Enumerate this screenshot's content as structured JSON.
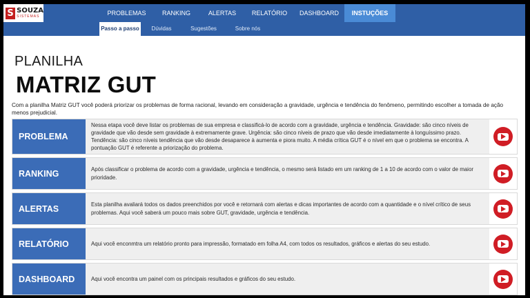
{
  "brand": {
    "name": "SOUZA",
    "sub": "SISTEMAS",
    "mark": "S"
  },
  "nav": {
    "items": [
      {
        "label": "PROBLEMAS"
      },
      {
        "label": "RANKING"
      },
      {
        "label": "ALERTAS"
      },
      {
        "label": "RELATÓRIO"
      },
      {
        "label": "DASHBOARD"
      },
      {
        "label": "INSTUÇÕES",
        "active": true
      }
    ]
  },
  "subnav": {
    "items": [
      {
        "label": "Passo a passo",
        "active": true
      },
      {
        "label": "Dúvidas"
      },
      {
        "label": "Sugestões"
      },
      {
        "label": "Sobre nós"
      }
    ]
  },
  "page": {
    "kicker": "PLANILHA",
    "title": "MATRIZ GUT",
    "intro": "Com a planilha Matriz GUT você poderá priorizar os problemas de forma racional, levando em consideração a gravidade, urgência e tendência do fenômeno, permitindo escolher a tomada de ação menos prejudicial."
  },
  "sections": [
    {
      "label": "PROBLEMA",
      "text": "Nessa etapa você deve listar os problemas de sua empresa e classificá-lo de acordo com a gravidade, urgência e tendência. Gravidade: são cinco níveis de gravidade que vão desde sem gravidade à extremamente grave. Urgência: são cinco  níveis de prazo que vão desde imediatamente à longuíssimo prazo. Tendência: são cinco níveis tendência que vão desde desaparece à aumenta e piora muito. A média crítica GUT é o nível em que o problema se encontra. A pontuação GUT é referente a priorização do problema.",
      "icon": "youtube-play-icon"
    },
    {
      "label": "RANKING",
      "text": "Após classificar o problema de acordo com a gravidade, urgência e tendência, o mesmo será listado em um ranking de 1 a 10 de acordo com o valor de maior prioridade.",
      "icon": "youtube-play-icon"
    },
    {
      "label": "ALERTAS",
      "text": "Esta planilha avaliará todos os dados preenchidos por você e retornará com alertas e dicas importantes de acordo com a quantidade e o nível crítico de seus problemas. Aqui você saberá um pouco mais sobre GUT, gravidade, urgência e tendência.",
      "icon": "youtube-play-icon"
    },
    {
      "label": "RELATÓRIO",
      "text": "Aqui você enconmtra um relatório pronto para impressão, formatado em folha A4, com todos os resultados, gráficos e alertas do seu estudo.",
      "icon": "youtube-play-icon"
    },
    {
      "label": "DASHBOARD",
      "text": "Aqui você encontra um painel com os principais resultados e gráficos do seu estudo.",
      "icon": "youtube-play-icon"
    }
  ],
  "colors": {
    "nav_bg": "#2f5fa6",
    "nav_active": "#4a8bd6",
    "section_label_bg": "#3b6cb7",
    "youtube_red": "#d01d25"
  }
}
